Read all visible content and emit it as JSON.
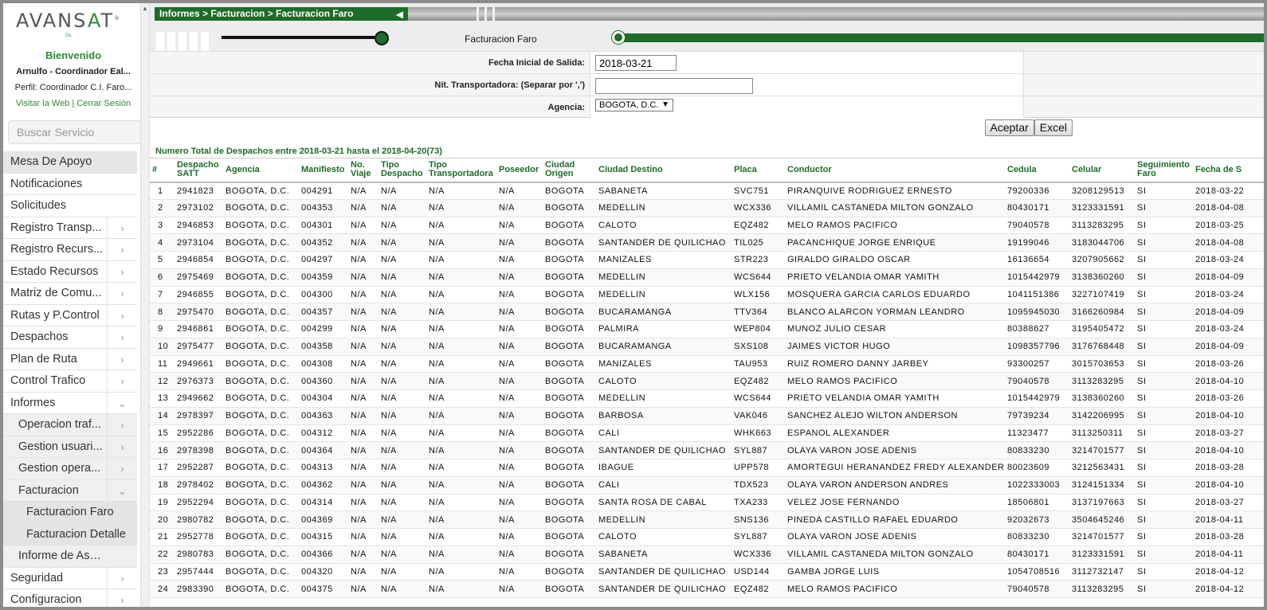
{
  "sidebar": {
    "logo_text_1": "AVANS",
    "logo_text_2": "A",
    "logo_text_3": "T",
    "logo_reg": "®",
    "logo_sub": "GL",
    "welcome": "Bienvenido",
    "user_name": "Arnulfo - Coordinador Eal...",
    "user_profile": "Perfil: Coordinador C.I. Faro...",
    "link_web": "Visitar la Web",
    "link_sep": "|",
    "link_logout": "Cerrar Sesión",
    "search_placeholder": "Buscar Servicio",
    "menu": [
      {
        "label": "Mesa De Apoyo",
        "level": 1,
        "arrow": "",
        "active": true
      },
      {
        "label": "Notificaciones",
        "level": 1,
        "arrow": ""
      },
      {
        "label": "Solicitudes",
        "level": 1,
        "arrow": ""
      },
      {
        "label": "Registro Transp...",
        "level": 1,
        "arrow": "›"
      },
      {
        "label": "Registro Recurs...",
        "level": 1,
        "arrow": "›"
      },
      {
        "label": "Estado Recursos",
        "level": 1,
        "arrow": "›"
      },
      {
        "label": "Matriz de Comu...",
        "level": 1,
        "arrow": "›"
      },
      {
        "label": "Rutas y P.Control",
        "level": 1,
        "arrow": "›"
      },
      {
        "label": "Despachos",
        "level": 1,
        "arrow": "›"
      },
      {
        "label": "Plan de Ruta",
        "level": 1,
        "arrow": "›"
      },
      {
        "label": "Control Trafico",
        "level": 1,
        "arrow": "›"
      },
      {
        "label": "Informes",
        "level": 1,
        "arrow": "⌄"
      },
      {
        "label": "Operacion traf...",
        "level": 2,
        "arrow": "›"
      },
      {
        "label": "Gestion usuari...",
        "level": 2,
        "arrow": "›"
      },
      {
        "label": "Gestion opera...",
        "level": 2,
        "arrow": "›"
      },
      {
        "label": "Facturacion",
        "level": 2,
        "arrow": "⌄"
      },
      {
        "label": "Facturacion Faro",
        "level": 3,
        "arrow": ""
      },
      {
        "label": "Facturacion Detalle",
        "level": 3,
        "arrow": ""
      },
      {
        "label": "Informe de Asignaci...",
        "level": 2,
        "arrow": ""
      },
      {
        "label": "Seguridad",
        "level": 1,
        "arrow": "›"
      },
      {
        "label": "Configuracion",
        "level": 1,
        "arrow": "›"
      }
    ]
  },
  "header": {
    "breadcrumb": "Informes > Facturacion > Facturacion Faro",
    "page_title": "Facturacion Faro"
  },
  "filters": {
    "fecha_label": "Fecha Inicial de Salida:",
    "fecha_value": "2018-03-21",
    "nit_label": "Nit. Transportadora:   (Separar por ',')",
    "nit_value": "",
    "agencia_label": "Agencia:",
    "agencia_value": "BOGOTA, D.C.",
    "accept_label": "Aceptar",
    "excel_label": "Excel"
  },
  "summary": "Numero Total de Despachos entre 2018-03-21 hasta el 2018-04-20(73)",
  "table": {
    "columns": [
      "#",
      "Despacho SATT",
      "Agencia",
      "Manifiesto",
      "No. Viaje",
      "Tipo Despacho",
      "Tipo Transportadora",
      "Poseedor",
      "Ciudad Origen",
      "Ciudad Destino",
      "Placa",
      "Conductor",
      "Cedula",
      "Celular",
      "Seguimiento Faro",
      "Fecha de S"
    ],
    "rows": [
      [
        "1",
        "2941823",
        "BOGOTA, D.C.",
        "004291",
        "N/A",
        "N/A",
        "N/A",
        "N/A",
        "BOGOTA",
        "SABANETA",
        "SVC751",
        "PIRANQUIVE RODRIGUEZ ERNESTO",
        "79200336",
        "3208129513",
        "SI",
        "2018-03-22"
      ],
      [
        "2",
        "2973102",
        "BOGOTA, D.C.",
        "004353",
        "N/A",
        "N/A",
        "N/A",
        "N/A",
        "BOGOTA",
        "MEDELLIN",
        "WCX336",
        "VILLAMIL CASTANEDA MILTON GONZALO",
        "80430171",
        "3123331591",
        "SI",
        "2018-04-08"
      ],
      [
        "3",
        "2946853",
        "BOGOTA, D.C.",
        "004301",
        "N/A",
        "N/A",
        "N/A",
        "N/A",
        "BOGOTA",
        "CALOTO",
        "EQZ482",
        "MELO RAMOS PACIFICO",
        "79040578",
        "3113283295",
        "SI",
        "2018-03-25"
      ],
      [
        "4",
        "2973104",
        "BOGOTA, D.C.",
        "004352",
        "N/A",
        "N/A",
        "N/A",
        "N/A",
        "BOGOTA",
        "SANTANDER DE QUILICHAO",
        "TIL025",
        "PACANCHIQUE JORGE ENRIQUE",
        "19199046",
        "3183044706",
        "SI",
        "2018-04-08"
      ],
      [
        "5",
        "2946854",
        "BOGOTA, D.C.",
        "004297",
        "N/A",
        "N/A",
        "N/A",
        "N/A",
        "BOGOTA",
        "MANIZALES",
        "STR223",
        "GIRALDO GIRALDO OSCAR",
        "16136654",
        "3207905662",
        "SI",
        "2018-03-24"
      ],
      [
        "6",
        "2975469",
        "BOGOTA, D.C.",
        "004359",
        "N/A",
        "N/A",
        "N/A",
        "N/A",
        "BOGOTA",
        "MEDELLIN",
        "WCS644",
        "PRIETO VELANDIA OMAR YAMITH",
        "1015442979",
        "3138360260",
        "SI",
        "2018-04-09"
      ],
      [
        "7",
        "2946855",
        "BOGOTA, D.C.",
        "004300",
        "N/A",
        "N/A",
        "N/A",
        "N/A",
        "BOGOTA",
        "MEDELLIN",
        "WLX156",
        "MOSQUERA GARCIA CARLOS EDUARDO",
        "1041151386",
        "3227107419",
        "SI",
        "2018-03-24"
      ],
      [
        "8",
        "2975470",
        "BOGOTA, D.C.",
        "004357",
        "N/A",
        "N/A",
        "N/A",
        "N/A",
        "BOGOTA",
        "BUCARAMANGA",
        "TTV364",
        "BLANCO ALARCON YORMAN LEANDRO",
        "1095945030",
        "3166260984",
        "SI",
        "2018-04-09"
      ],
      [
        "9",
        "2946861",
        "BOGOTA, D.C.",
        "004299",
        "N/A",
        "N/A",
        "N/A",
        "N/A",
        "BOGOTA",
        "PALMIRA",
        "WEP804",
        "MUNOZ JULIO CESAR",
        "80388627",
        "3195405472",
        "SI",
        "2018-03-24"
      ],
      [
        "10",
        "2975477",
        "BOGOTA, D.C.",
        "004358",
        "N/A",
        "N/A",
        "N/A",
        "N/A",
        "BOGOTA",
        "BUCARAMANGA",
        "SXS108",
        "JAIMES VICTOR HUGO",
        "1098357796",
        "3176768448",
        "SI",
        "2018-04-09"
      ],
      [
        "11",
        "2949661",
        "BOGOTA, D.C.",
        "004308",
        "N/A",
        "N/A",
        "N/A",
        "N/A",
        "BOGOTA",
        "MANIZALES",
        "TAU953",
        "RUIZ ROMERO DANNY JARBEY",
        "93300257",
        "3015703653",
        "SI",
        "2018-03-26"
      ],
      [
        "12",
        "2976373",
        "BOGOTA, D.C.",
        "004360",
        "N/A",
        "N/A",
        "N/A",
        "N/A",
        "BOGOTA",
        "CALOTO",
        "EQZ482",
        "MELO RAMOS PACIFICO",
        "79040578",
        "3113283295",
        "SI",
        "2018-04-10"
      ],
      [
        "13",
        "2949662",
        "BOGOTA, D.C.",
        "004304",
        "N/A",
        "N/A",
        "N/A",
        "N/A",
        "BOGOTA",
        "MEDELLIN",
        "WCS644",
        "PRIETO VELANDIA OMAR YAMITH",
        "1015442979",
        "3138360260",
        "SI",
        "2018-03-26"
      ],
      [
        "14",
        "2978397",
        "BOGOTA, D.C.",
        "004363",
        "N/A",
        "N/A",
        "N/A",
        "N/A",
        "BOGOTA",
        "BARBOSA",
        "VAK046",
        "SANCHEZ ALEJO WILTON ANDERSON",
        "79739234",
        "3142206995",
        "SI",
        "2018-04-10"
      ],
      [
        "15",
        "2952286",
        "BOGOTA, D.C.",
        "004312",
        "N/A",
        "N/A",
        "N/A",
        "N/A",
        "BOGOTA",
        "CALI",
        "WHK663",
        "ESPANOL ALEXANDER",
        "11323477",
        "3113250311",
        "SI",
        "2018-03-27"
      ],
      [
        "16",
        "2978398",
        "BOGOTA, D.C.",
        "004364",
        "N/A",
        "N/A",
        "N/A",
        "N/A",
        "BOGOTA",
        "SANTANDER DE QUILICHAO",
        "SYL887",
        "OLAYA VARON JOSE ADENIS",
        "80833230",
        "3214701577",
        "SI",
        "2018-04-10"
      ],
      [
        "17",
        "2952287",
        "BOGOTA, D.C.",
        "004313",
        "N/A",
        "N/A",
        "N/A",
        "N/A",
        "BOGOTA",
        "IBAGUE",
        "UPP578",
        "AMORTEGUI HERANANDEZ FREDY ALEXANDER",
        "80023609",
        "3212563431",
        "SI",
        "2018-03-28"
      ],
      [
        "18",
        "2978402",
        "BOGOTA, D.C.",
        "004362",
        "N/A",
        "N/A",
        "N/A",
        "N/A",
        "BOGOTA",
        "CALI",
        "TDX523",
        "OLAYA VARON ANDERSON ANDRES",
        "1022333003",
        "3124151334",
        "SI",
        "2018-04-10"
      ],
      [
        "19",
        "2952294",
        "BOGOTA, D.C.",
        "004314",
        "N/A",
        "N/A",
        "N/A",
        "N/A",
        "BOGOTA",
        "SANTA ROSA DE CABAL",
        "TXA233",
        "VELEZ JOSE FERNANDO",
        "18506801",
        "3137197663",
        "SI",
        "2018-03-27"
      ],
      [
        "20",
        "2980782",
        "BOGOTA, D.C.",
        "004369",
        "N/A",
        "N/A",
        "N/A",
        "N/A",
        "BOGOTA",
        "MEDELLIN",
        "SNS136",
        "PINEDA CASTILLO RAFAEL EDUARDO",
        "92032673",
        "3504645246",
        "SI",
        "2018-04-11"
      ],
      [
        "21",
        "2952778",
        "BOGOTA, D.C.",
        "004315",
        "N/A",
        "N/A",
        "N/A",
        "N/A",
        "BOGOTA",
        "CALOTO",
        "SYL887",
        "OLAYA VARON JOSE ADENIS",
        "80833230",
        "3214701577",
        "SI",
        "2018-03-28"
      ],
      [
        "22",
        "2980783",
        "BOGOTA, D.C.",
        "004366",
        "N/A",
        "N/A",
        "N/A",
        "N/A",
        "BOGOTA",
        "SABANETA",
        "WCX336",
        "VILLAMIL CASTANEDA MILTON GONZALO",
        "80430171",
        "3123331591",
        "SI",
        "2018-04-11"
      ],
      [
        "23",
        "2957444",
        "BOGOTA, D.C.",
        "004320",
        "N/A",
        "N/A",
        "N/A",
        "N/A",
        "BOGOTA",
        "SANTANDER DE QUILICHAO",
        "USD144",
        "GAMBA JORGE LUIS",
        "1054708516",
        "3112732147",
        "SI",
        "2018-04-12"
      ],
      [
        "24",
        "2983390",
        "BOGOTA, D.C.",
        "004375",
        "N/A",
        "N/A",
        "N/A",
        "N/A",
        "BOGOTA",
        "SANTANDER DE QUILICHAO",
        "EQZ482",
        "MELO RAMOS PACIFICO",
        "79040578",
        "3113283295",
        "SI",
        "2018-04-12"
      ]
    ]
  },
  "colors": {
    "brand_green": "#1e6b2a",
    "accent_green": "#2e8b3a",
    "text": "#111111"
  }
}
